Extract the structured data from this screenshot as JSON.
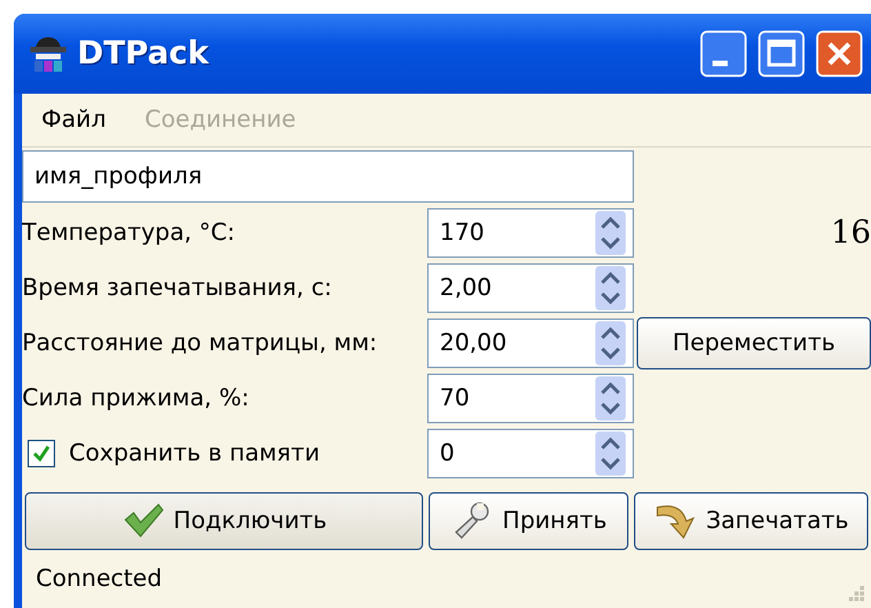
{
  "window": {
    "title": "DTPack"
  },
  "menu": [
    {
      "label": "Файл",
      "disabled": false
    },
    {
      "label": "Соединение",
      "disabled": true
    }
  ],
  "profile_name": {
    "value": "имя_профиля"
  },
  "fields": [
    {
      "label": "Температура, °C:",
      "value": "170"
    },
    {
      "label": "Время запечатывания, с:",
      "value": "2,00"
    },
    {
      "label": "Расстояние до матрицы, мм:",
      "value": "20,00"
    },
    {
      "label": "Сила прижима, %:",
      "value": "70"
    }
  ],
  "save_in_memory": {
    "label": "Сохранить в памяти",
    "checked": true,
    "value": "0"
  },
  "counter": "16",
  "move_button": {
    "label": "Переместить"
  },
  "buttons": [
    {
      "label": "Подключить",
      "kind": "connect",
      "focused": true
    },
    {
      "label": "Принять",
      "kind": "accept",
      "focused": false
    },
    {
      "label": "Запечатать",
      "kind": "seal",
      "focused": false
    }
  ],
  "status_bar": {
    "text": "Connected"
  }
}
